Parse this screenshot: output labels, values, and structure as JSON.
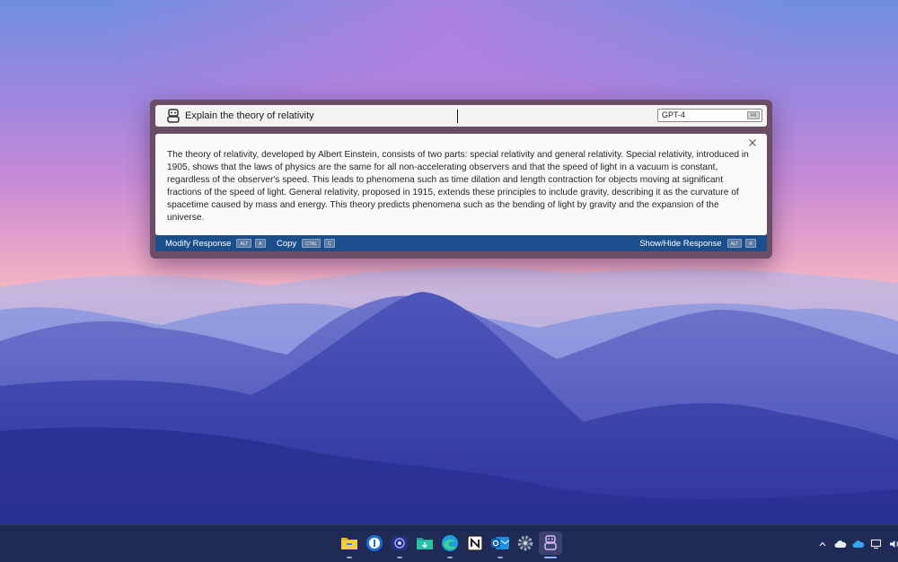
{
  "assistant": {
    "prompt_value": "Explain the theory of relativity",
    "model_selected": "GPT-4",
    "model_shortcut": "F9",
    "response_text": "The theory of relativity, developed by Albert Einstein, consists of two parts: special relativity and general relativity. Special relativity, introduced in 1905, shows that the laws of physics are the same for all non-accelerating observers and that the speed of light in a vacuum is constant, regardless of the observer's speed. This leads to phenomena such as time dilation and length contraction for objects moving at significant fractions of the speed of light. General relativity, proposed in 1915, extends these principles to include gravity, describing it as the curvature of spacetime caused by mass and energy. This theory predicts phenomena such as the bending of light by gravity and the expansion of the universe.",
    "actions": {
      "modify": {
        "label": "Modify Response",
        "keys": [
          "ALT",
          "A"
        ]
      },
      "copy": {
        "label": "Copy",
        "keys": [
          "CTRL",
          "C"
        ]
      },
      "toggle": {
        "label": "Show/Hide Response",
        "keys": [
          "ALT",
          "R"
        ]
      }
    },
    "colors": {
      "frame": "#6b4e66",
      "action_bar": "#1b4f8c"
    }
  },
  "taskbar": {
    "apps": [
      {
        "icon": "file-explorer-icon"
      },
      {
        "icon": "password-manager-icon"
      },
      {
        "icon": "camera-app-icon"
      },
      {
        "icon": "download-folder-icon"
      },
      {
        "icon": "edge-browser-icon"
      },
      {
        "icon": "notion-icon"
      },
      {
        "icon": "outlook-icon"
      },
      {
        "icon": "settings-gear-icon"
      },
      {
        "icon": "ai-assistant-icon"
      }
    ],
    "tray": [
      {
        "icon": "chevron-up-icon"
      },
      {
        "icon": "onedrive-cloud-icon"
      },
      {
        "icon": "onedrive-cloud-blue-icon"
      },
      {
        "icon": "display-icon"
      },
      {
        "icon": "volume-icon"
      }
    ]
  }
}
